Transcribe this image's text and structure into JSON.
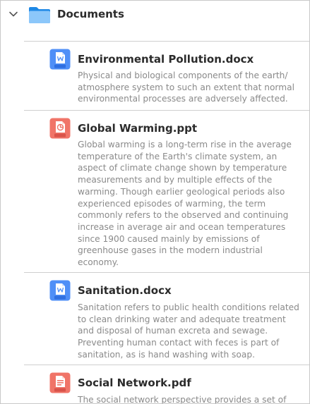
{
  "folder": {
    "title": "Documents",
    "expanded_icon": "chevron-down-icon",
    "icon": "folder-icon",
    "color": "#2d8cf0"
  },
  "files": [
    {
      "name": "Environmental Pollution.docx",
      "type_label": "Word",
      "icon": "word-file-icon",
      "description": "Physical and biological components of the earth/ atmosphere system to such an extent that normal environmental processes are adversely affected."
    },
    {
      "name": "Global Warming.ppt",
      "type_label": "PPT",
      "icon": "ppt-file-icon",
      "description": "Global warming is a long-term rise in the average temperature of the Earth's climate system, an aspect of climate change shown by temperature measurements and by multiple effects of the warming. Though earlier geological periods also experienced episodes of warming, the term commonly refers to the observed and continuing increase in average air and ocean temperatures since 1900 caused mainly by emissions of greenhouse gases in the modern industrial economy."
    },
    {
      "name": "Sanitation.docx",
      "type_label": "Word",
      "icon": "word-file-icon",
      "description": "Sanitation refers to public health conditions related to clean drinking water and adequate treatment and disposal of human excreta and sewage. Preventing human contact with feces is part of sanitation, as is hand washing with soap."
    },
    {
      "name": "Social Network.pdf",
      "type_label": "PDF",
      "icon": "pdf-file-icon",
      "description": "The social network perspective provides a set of"
    }
  ],
  "colors": {
    "word": "#4f8ff7",
    "ppt": "#f07468",
    "pdf": "#f07468",
    "description_text": "#8a8a8a",
    "divider": "#cfcfcf"
  }
}
